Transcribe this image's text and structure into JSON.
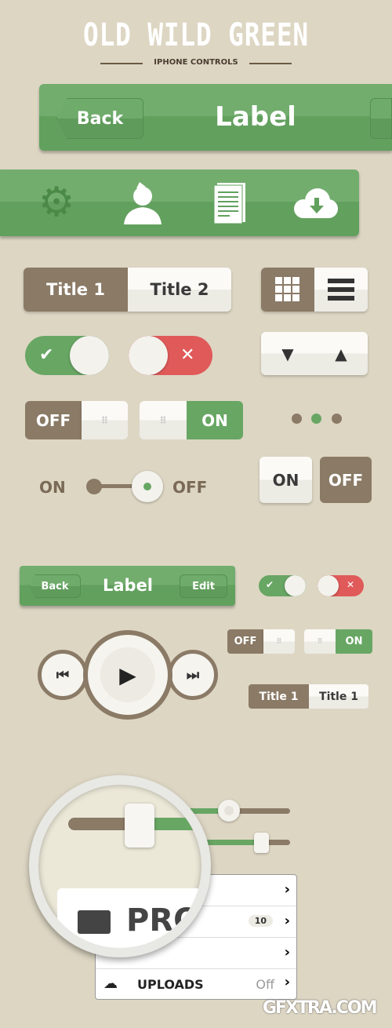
{
  "header": {
    "title": "OLD WILD GREEN",
    "subtitle": "IPHONE CONTROLS"
  },
  "navbar": {
    "back": "Back",
    "label": "Label"
  },
  "tabbar": {
    "icons": [
      "gear-icon",
      "user-icon",
      "document-icon",
      "cloud-download-icon"
    ]
  },
  "segmented": {
    "items": [
      "Title 1",
      "Title 2"
    ],
    "selected": 0
  },
  "view_switch": {
    "icons": [
      "grid-icon",
      "list-icon"
    ],
    "selected": 0
  },
  "toggles": {
    "check": "✔",
    "x": "✕"
  },
  "switch": {
    "off": "OFF",
    "on": "ON"
  },
  "page_dots": {
    "count": 3,
    "active": 1
  },
  "slider_switch": {
    "on": "ON",
    "off": "OFF"
  },
  "buttons": {
    "on": "ON",
    "off": "OFF"
  },
  "small_navbar": {
    "back": "Back",
    "label": "Label",
    "edit": "Edit"
  },
  "small_switch": {
    "off": "OFF",
    "on": "ON"
  },
  "small_segmented": {
    "items": [
      "Title 1",
      "Title 1"
    ]
  },
  "sliders": [
    {
      "value": 0.4
    },
    {
      "value": 0.7
    }
  ],
  "magnifier": {
    "text": "PRO"
  },
  "list": {
    "items": [
      {
        "label": "",
        "value": ""
      },
      {
        "label": "",
        "badge": "10"
      },
      {
        "label": "",
        "value": ""
      },
      {
        "label": "UPLOADS",
        "value": "Off"
      }
    ]
  },
  "watermark": "GFXTRA.COM",
  "colors": {
    "green": "#68a664",
    "brown": "#8a7a66",
    "red": "#e05a5a",
    "background": "#ddd6c3"
  }
}
